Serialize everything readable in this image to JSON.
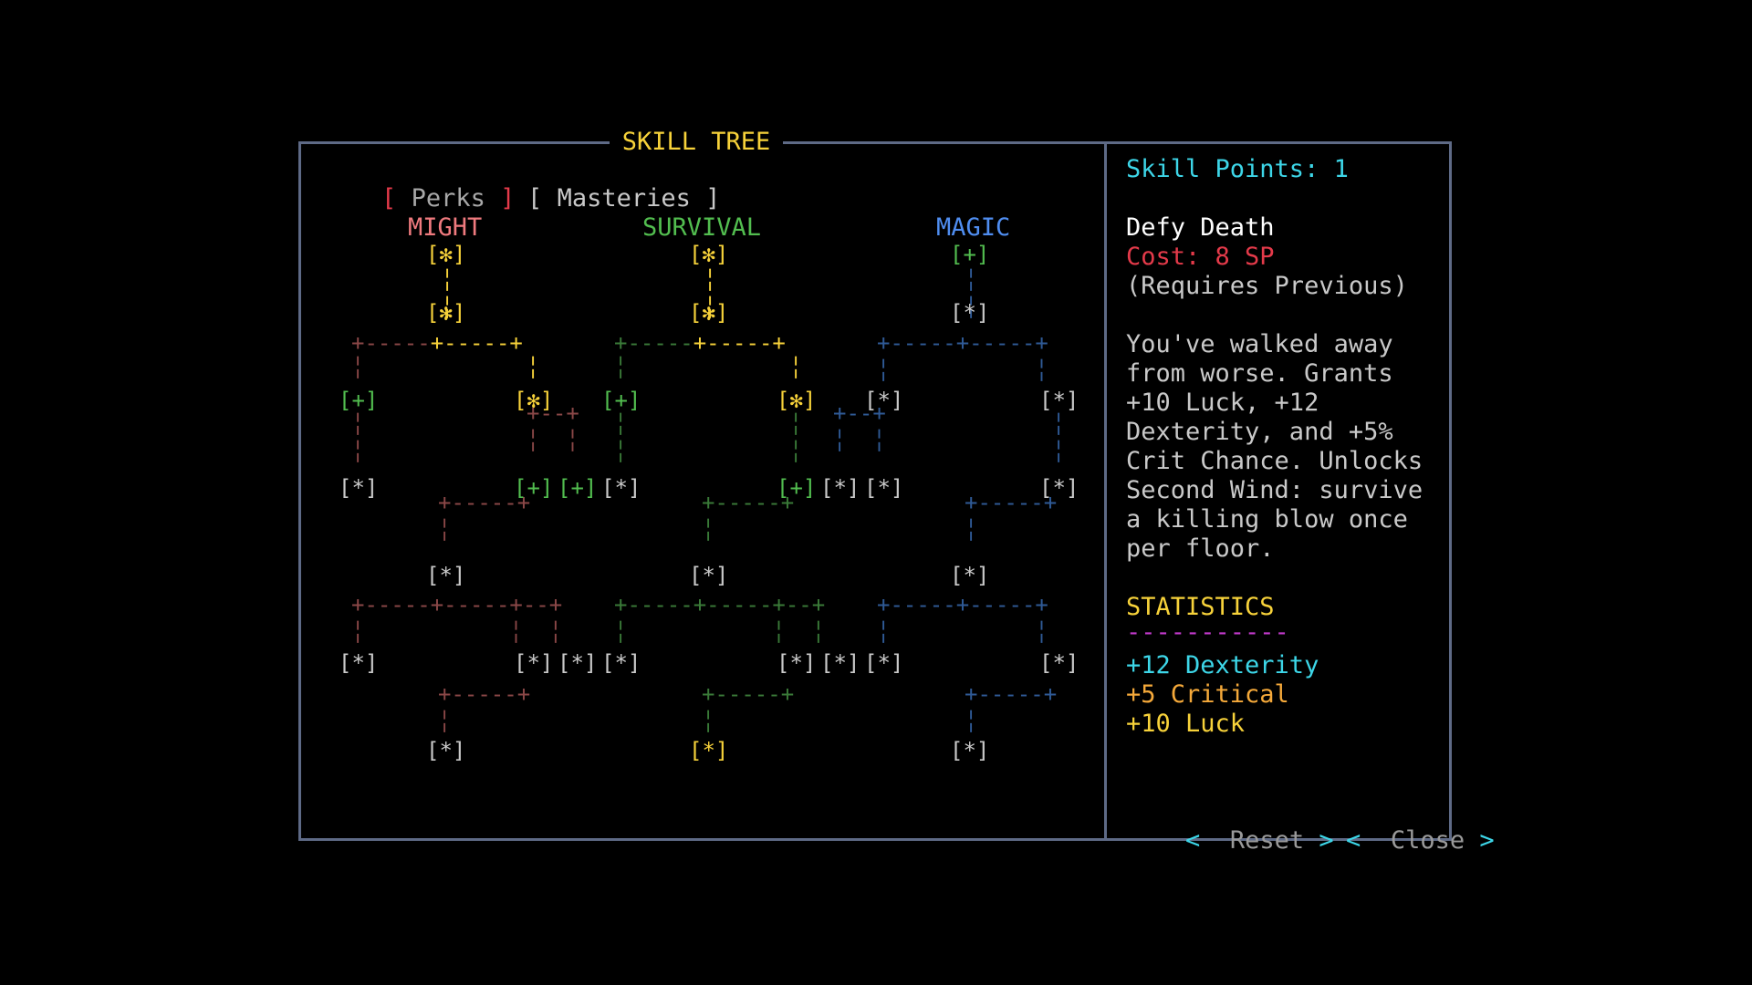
{
  "window": {
    "title": "SKILL TREE"
  },
  "tabs": {
    "perks": {
      "open": "[",
      "label": "Perks",
      "close": "]"
    },
    "masteries": {
      "open": "[",
      "label": "Masteries",
      "close": "]"
    }
  },
  "branches": [
    {
      "name": "MIGHT",
      "color": "#ef7a7e"
    },
    {
      "name": "SURVIVAL",
      "color": "#52bd4f"
    },
    {
      "name": "MAGIC",
      "color": "#4f8df0"
    }
  ],
  "colors": {
    "yellow": "#f7d23a",
    "green": "#52bd4f",
    "gray": "#c9c9c9",
    "might_line": "#8a4747",
    "survival_line": "#3a7a38",
    "magic_line": "#2f5a96",
    "border": "#5e6a86",
    "cyan": "#3dd6e8",
    "red": "#e43a4a",
    "magenta": "#c23acb",
    "orange": "#f5a93a"
  },
  "tree": {
    "nodes": [
      {
        "label": "[✻]",
        "col": "yellow"
      },
      {
        "label": "[✻]",
        "col": "yellow"
      },
      {
        "label": "[+]",
        "col": "green"
      },
      {
        "label": "[✻]",
        "col": "yellow"
      },
      {
        "label": "[✻]",
        "col": "yellow"
      },
      {
        "label": "[*]",
        "col": "gray"
      },
      {
        "label": "[+]",
        "col": "green"
      },
      {
        "label": "[✻]",
        "col": "yellow"
      },
      {
        "label": "[+]",
        "col": "green"
      },
      {
        "label": "[✻]",
        "col": "yellow"
      },
      {
        "label": "[*]",
        "col": "gray"
      },
      {
        "label": "[*]",
        "col": "gray"
      },
      {
        "label": "[*]",
        "col": "gray"
      },
      {
        "label": "[+]",
        "col": "green"
      },
      {
        "label": "[+]",
        "col": "green"
      },
      {
        "label": "[*]",
        "col": "gray"
      },
      {
        "label": "[+]",
        "col": "green"
      },
      {
        "label": "[*]",
        "col": "gray"
      },
      {
        "label": "[*]",
        "col": "gray"
      },
      {
        "label": "[*]",
        "col": "gray"
      },
      {
        "label": "[*]",
        "col": "gray"
      },
      {
        "label": "[*]",
        "col": "gray"
      },
      {
        "label": "[*]",
        "col": "gray"
      },
      {
        "label": "[*]",
        "col": "gray"
      },
      {
        "label": "[*]",
        "col": "gray"
      },
      {
        "label": "[*]",
        "col": "gray"
      },
      {
        "label": "[*]",
        "col": "gray"
      },
      {
        "label": "[*]",
        "col": "gray"
      },
      {
        "label": "[*]",
        "col": "gray"
      },
      {
        "label": "[*]",
        "col": "gray"
      },
      {
        "label": "[*]",
        "col": "gray"
      },
      {
        "label": "[*]",
        "col": "gray"
      },
      {
        "label": "[*]",
        "col": "yellow"
      },
      {
        "label": "[*]",
        "col": "gray"
      }
    ]
  },
  "panel": {
    "skill_points": "Skill Points: 1",
    "skill_name": "Defy Death",
    "cost": "Cost: 8 SP",
    "requires": "(Requires Previous)",
    "description": [
      "You've walked away",
      "from worse. Grants",
      "+10 Luck, +12",
      "Dexterity, and +5%",
      "Crit Chance. Unlocks",
      "Second Wind: survive",
      "a killing blow once",
      "per floor."
    ],
    "statistics_heading": "STATISTICS",
    "statistics_rule": "-----------",
    "stats": [
      {
        "text": "+12 Dexterity",
        "color": "#3dd6e8"
      },
      {
        "text": "+5 Critical",
        "color": "#f5a93a"
      },
      {
        "text": "+10 Luck",
        "color": "#f7d23a"
      }
    ],
    "buttons": {
      "reset": {
        "left": "<",
        "label": "Reset",
        "right": ">"
      },
      "close": {
        "left": "<",
        "label": "Close",
        "right": ">"
      }
    }
  }
}
